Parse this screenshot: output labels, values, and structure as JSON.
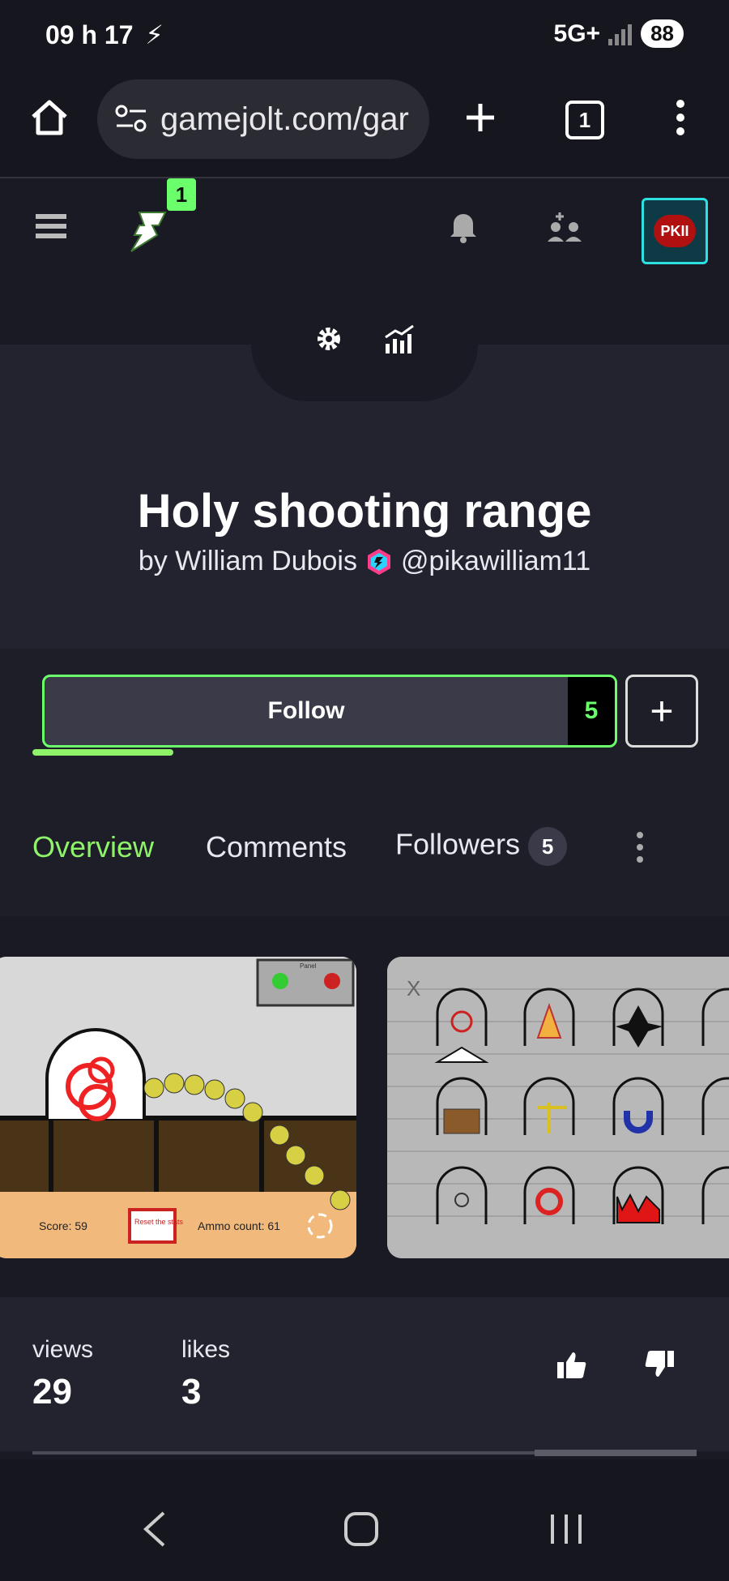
{
  "status": {
    "time": "09 h 17",
    "network": "5G+",
    "battery": "88"
  },
  "browser": {
    "url": "gamejolt.com/gar",
    "tab_count": "1"
  },
  "header": {
    "notification_badge": "1",
    "avatar_text": "PKII"
  },
  "game": {
    "title": "Holy shooting range",
    "by_prefix": "by William Dubois",
    "handle": "@pikawilliam11"
  },
  "follow": {
    "label": "Follow",
    "count": "5",
    "add_label": "+"
  },
  "tabs": [
    {
      "label": "Overview"
    },
    {
      "label": "Comments"
    },
    {
      "label": "Followers",
      "badge": "5"
    }
  ],
  "screenshot1": {
    "score": "Score: 59",
    "reset": "Reset the stats",
    "ammo": "Ammo count: 61",
    "panel": "Panel"
  },
  "stats": {
    "views_label": "views",
    "views": "29",
    "likes_label": "likes",
    "likes": "3"
  },
  "colors": {
    "accent": "#8ff36a",
    "bg": "#1a1a24"
  }
}
